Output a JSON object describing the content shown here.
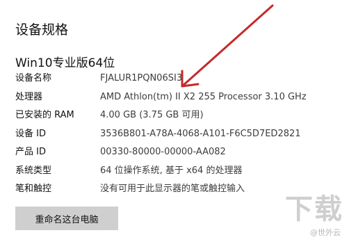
{
  "section_title": "设备规格",
  "edition": "Win10专业版64位",
  "specs": [
    {
      "label": "设备名称",
      "value": "FJALUR1PQN06SI3"
    },
    {
      "label": "处理器",
      "value": "AMD Athlon(tm) II X2 255 Processor   3.10 GHz"
    },
    {
      "label": "已安装的 RAM",
      "value": "4.00 GB (3.75 GB 可用)"
    },
    {
      "label": "设备 ID",
      "value": "3536B801-A78A-4068-A101-F6C5D7ED2821"
    },
    {
      "label": "产品 ID",
      "value": "00330-80000-00000-AA082"
    },
    {
      "label": "系统类型",
      "value": "64 位操作系统, 基于 x64 的处理器"
    },
    {
      "label": "笔和触控",
      "value": "没有可用于此显示器的笔或触控输入"
    }
  ],
  "rename_button_label": "重命名这台电脑",
  "watermark": {
    "big": "下载",
    "small": "@世外云"
  },
  "annotation_color": "#c62828"
}
